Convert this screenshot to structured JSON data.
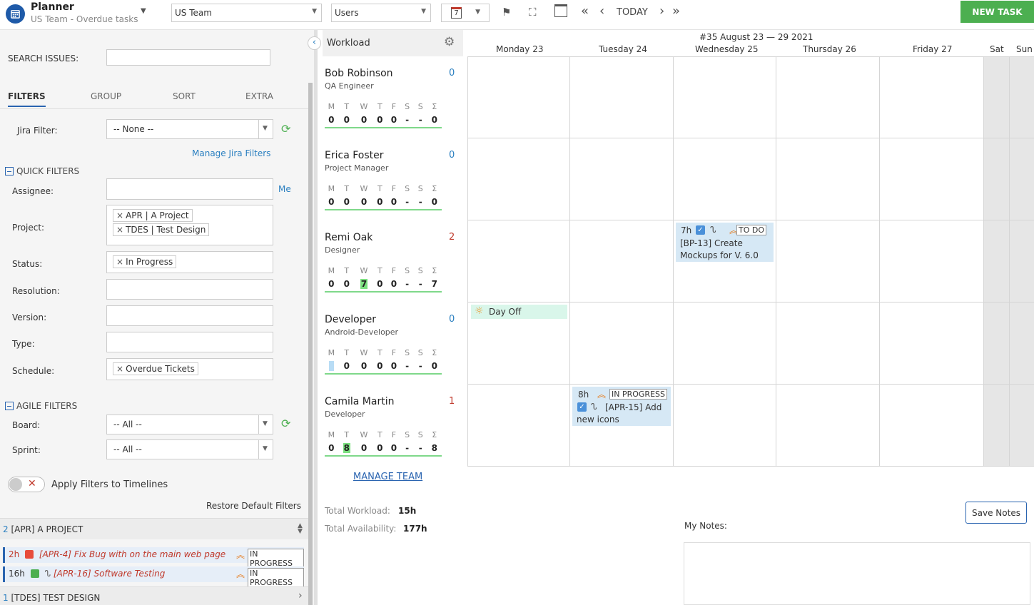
{
  "header": {
    "app_title": "Planner",
    "app_subtitle": "US Team - Overdue tasks",
    "team_select": "US Team",
    "view_select": "Users",
    "cal_day": "7",
    "today": "TODAY",
    "new_task": "NEW TASK"
  },
  "left": {
    "search_label": "SEARCH ISSUES:",
    "tabs": [
      "FILTERS",
      "GROUP",
      "SORT",
      "EXTRA"
    ],
    "jira_filter_label": "Jira Filter:",
    "jira_filter_value": "-- None --",
    "manage_jira": "Manage Jira Filters",
    "quick_filters": "QUICK FILTERS",
    "assignee_label": "Assignee:",
    "me": "Me",
    "project_label": "Project:",
    "project_tags": [
      "APR | A Project",
      "TDES | Test Design"
    ],
    "status_label": "Status:",
    "status_tags": [
      "In Progress"
    ],
    "resolution_label": "Resolution:",
    "version_label": "Version:",
    "type_label": "Type:",
    "schedule_label": "Schedule:",
    "schedule_tags": [
      "Overdue Tickets"
    ],
    "agile_filters": "AGILE FILTERS",
    "board_label": "Board:",
    "board_value": "-- All --",
    "sprint_label": "Sprint:",
    "sprint_value": "-- All --",
    "apply_label": "Apply Filters to Timelines",
    "restore": "Restore Default Filters",
    "group1_count": "2",
    "group1_name": "[APR] A PROJECT",
    "tasks": [
      {
        "hours": "2h",
        "title": "[APR-4] Fix Bug with on the main web page",
        "status": "IN PROGRESS"
      },
      {
        "hours": "16h",
        "title": "[APR-16] Software Testing",
        "status": "IN PROGRESS"
      }
    ],
    "group2_count": "1",
    "group2_name": "[TDES] TEST DESIGN"
  },
  "workload": {
    "title": "Workload",
    "day_letters": [
      "M",
      "T",
      "W",
      "T",
      "F",
      "S",
      "S",
      "Σ"
    ],
    "users": [
      {
        "name": "Bob Robinson",
        "role": "QA Engineer",
        "count": "0",
        "count_color": "#2a7fc0",
        "vals": [
          "0",
          "0",
          "0",
          "0",
          "0",
          "-",
          "-",
          "0"
        ]
      },
      {
        "name": "Erica Foster",
        "role": "Project Manager",
        "count": "0",
        "count_color": "#2a7fc0",
        "vals": [
          "0",
          "0",
          "0",
          "0",
          "0",
          "-",
          "-",
          "0"
        ]
      },
      {
        "name": "Remi Oak",
        "role": "Designer",
        "count": "2",
        "count_color": "#c0392b",
        "vals": [
          "0",
          "0",
          "7",
          "0",
          "0",
          "-",
          "-",
          "7"
        ]
      },
      {
        "name": "Developer",
        "role": "Android-Developer",
        "count": "0",
        "count_color": "#2a7fc0",
        "vals": [
          "-",
          "0",
          "0",
          "0",
          "0",
          "-",
          "-",
          "0"
        ]
      },
      {
        "name": "Camila Martin",
        "role": "Developer",
        "count": "1",
        "count_color": "#c0392b",
        "vals": [
          "0",
          "8",
          "0",
          "0",
          "0",
          "-",
          "-",
          "8"
        ]
      }
    ],
    "manage_team": "MANAGE TEAM",
    "total_workload_label": "Total Workload:",
    "total_workload": "15h",
    "total_avail_label": "Total Availability:",
    "total_avail": "177h"
  },
  "calendar": {
    "week": "#35 August 23 — 29 2021",
    "days": [
      "Monday 23",
      "Tuesday 24",
      "Wednesday 25",
      "Thursday 26",
      "Friday 27",
      "Sat",
      "Sun"
    ],
    "card1": {
      "hours": "7h",
      "status": "TO DO",
      "title": "[BP-13] Create Mockups for V. 6.0"
    },
    "dayoff": "Day Off",
    "card2": {
      "hours": "8h",
      "status": "IN PROGRESS",
      "title": "[APR-15] Add new icons"
    }
  },
  "notes": {
    "save": "Save Notes",
    "label": "My Notes:"
  }
}
